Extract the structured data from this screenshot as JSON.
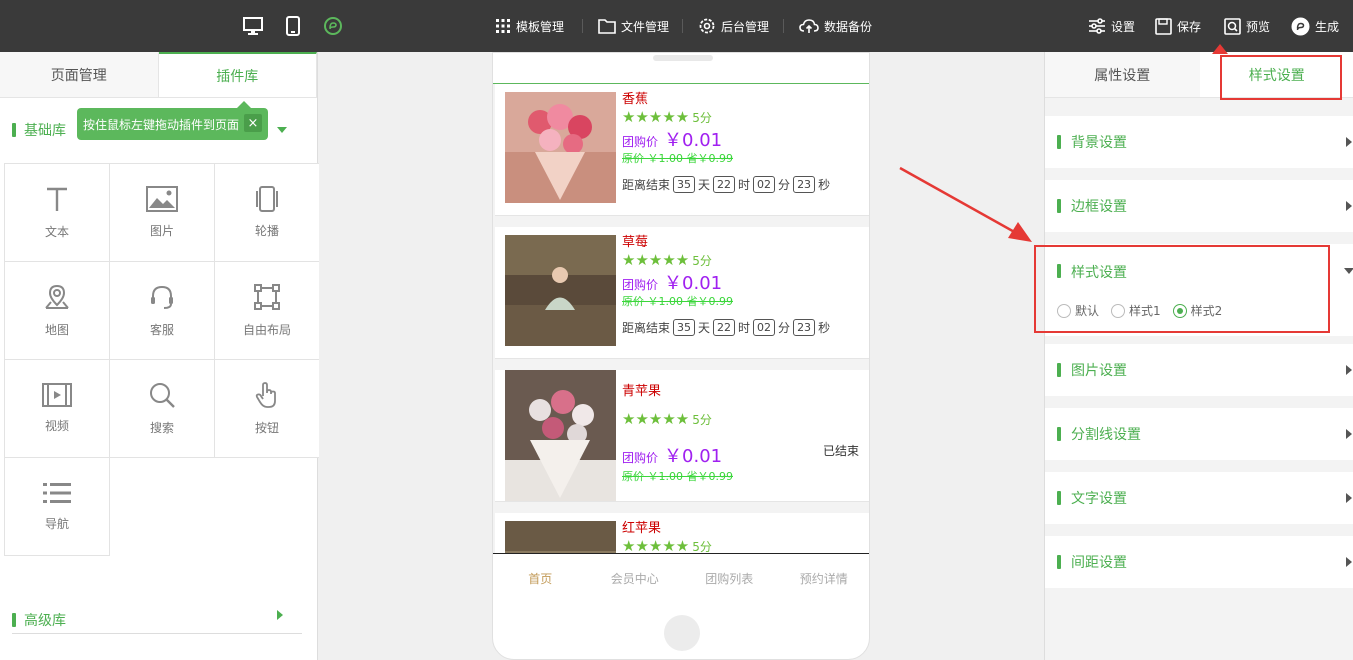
{
  "topbar": {
    "devices": [
      "desktop-icon",
      "mobile-icon",
      "mini-program-icon"
    ],
    "menu": [
      {
        "label": "模板管理",
        "icon": "grid-icon"
      },
      {
        "label": "文件管理",
        "icon": "file-icon"
      },
      {
        "label": "后台管理",
        "icon": "gear-icon"
      },
      {
        "label": "数据备份",
        "icon": "cloud-upload-icon"
      }
    ],
    "actions": [
      {
        "label": "设置",
        "icon": "sliders-icon"
      },
      {
        "label": "保存",
        "icon": "save-icon"
      },
      {
        "label": "预览",
        "icon": "preview-icon"
      },
      {
        "label": "生成",
        "icon": "generate-icon"
      }
    ]
  },
  "left": {
    "tabs": [
      "页面管理",
      "插件库"
    ],
    "basic_lib": "基础库",
    "tooltip": "按住鼠标左键拖动插件到页面",
    "tooltip_close": "×",
    "plugins": [
      "文本",
      "图片",
      "轮播",
      "地图",
      "客服",
      "自由布局",
      "视频",
      "搜索",
      "按钮",
      "导航"
    ],
    "advanced_lib": "高级库"
  },
  "phone": {
    "products": [
      {
        "name": "香蕉",
        "score": "5分",
        "price_label": "团购价",
        "price": "￥0.01",
        "original": "原价 ￥1.00 省￥0.99",
        "countdown": {
          "prefix": "距离结束",
          "days": "35",
          "d": "天",
          "hours": "22",
          "h": "时",
          "mins": "02",
          "m": "分",
          "secs": "23",
          "s": "秒"
        }
      },
      {
        "name": "草莓",
        "score": "5分",
        "price_label": "团购价",
        "price": "￥0.01",
        "original": "原价 ￥1.00 省￥0.99",
        "countdown": {
          "prefix": "距离结束",
          "days": "35",
          "d": "天",
          "hours": "22",
          "h": "时",
          "mins": "02",
          "m": "分",
          "secs": "23",
          "s": "秒"
        }
      },
      {
        "name": "青苹果",
        "score": "5分",
        "price_label": "团购价",
        "price": "￥0.01",
        "original": "原价 ￥1.00 省￥0.99",
        "status": "已结束"
      },
      {
        "name": "红苹果",
        "score": "5分"
      }
    ],
    "nav": [
      "首页",
      "会员中心",
      "团购列表",
      "预约详情"
    ]
  },
  "right": {
    "tabs": [
      "属性设置",
      "样式设置"
    ],
    "sections": [
      "背景设置",
      "边框设置",
      "样式设置",
      "图片设置",
      "分割线设置",
      "文字设置",
      "间距设置"
    ],
    "style_options": [
      "默认",
      "样式1",
      "样式2"
    ],
    "selected_style": "样式2"
  },
  "colors": {
    "accent": "#4caf50",
    "topbar": "#3a3a3a",
    "highlight": "#e53935",
    "price": "#a020f0"
  }
}
